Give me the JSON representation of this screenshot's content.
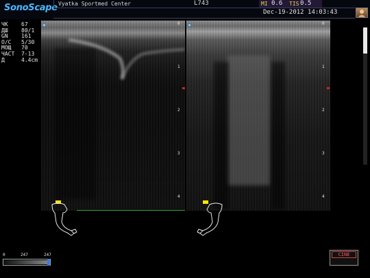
{
  "header": {
    "logo": "SonoScape",
    "institution": "Vyatka Sportmed Center",
    "probe": "L743",
    "mi_label": "MI",
    "mi_value": "0.6",
    "tis_label": "TIS",
    "tis_value": "0.5",
    "datetime": "Dec-19-2012 14:03:43"
  },
  "params": [
    {
      "label": "ЧК",
      "value": "67"
    },
    {
      "label": "ДШ",
      "value": "80/1"
    },
    {
      "label": "GN",
      "value": "161"
    },
    {
      "label": "O/C",
      "value": "5/30"
    },
    {
      "label": "МОЩ",
      "value": "70"
    },
    {
      "label": "ЧАСТ",
      "value": "7-13"
    },
    {
      "label": "Д",
      "value": "4.4cm"
    }
  ],
  "depth_scale": [
    "0",
    "1",
    "2",
    "3",
    "4"
  ],
  "gray_bar": {
    "min": "0",
    "mid": "247",
    "max": "247"
  },
  "cine_label": "CINE",
  "colors": {
    "accent_blue": "#49b8ff",
    "label_yellow": "#e8d84a",
    "focus_red": "#c62828",
    "baseline_green": "#2fa12f"
  },
  "icons": [
    "user-avatar-icon",
    "body-mark-arm-icon",
    "probe-position-icon"
  ]
}
